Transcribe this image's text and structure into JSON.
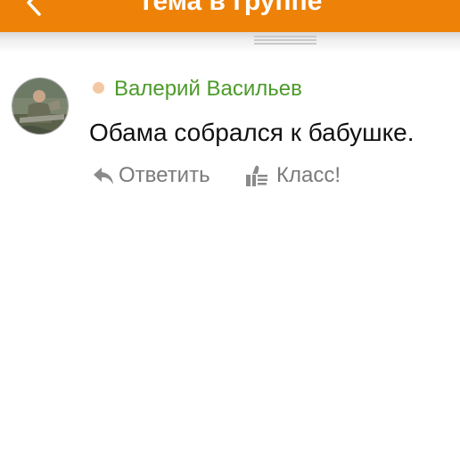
{
  "header": {
    "title": "Тема в группе",
    "back_icon": "chevron-left-icon",
    "background_color": "#ee8208"
  },
  "comment": {
    "author": "Валерий Васильев",
    "author_color": "#4b9b2a",
    "online_indicator_color": "#f3c9a3",
    "text": "Обама собрался к бабушке.",
    "avatar_icon": "user-photo-avatar",
    "actions": {
      "reply_label": "Ответить",
      "reply_icon": "reply-arrow-icon",
      "like_label": "Класс!",
      "like_icon": "thumbs-up-icon"
    }
  }
}
